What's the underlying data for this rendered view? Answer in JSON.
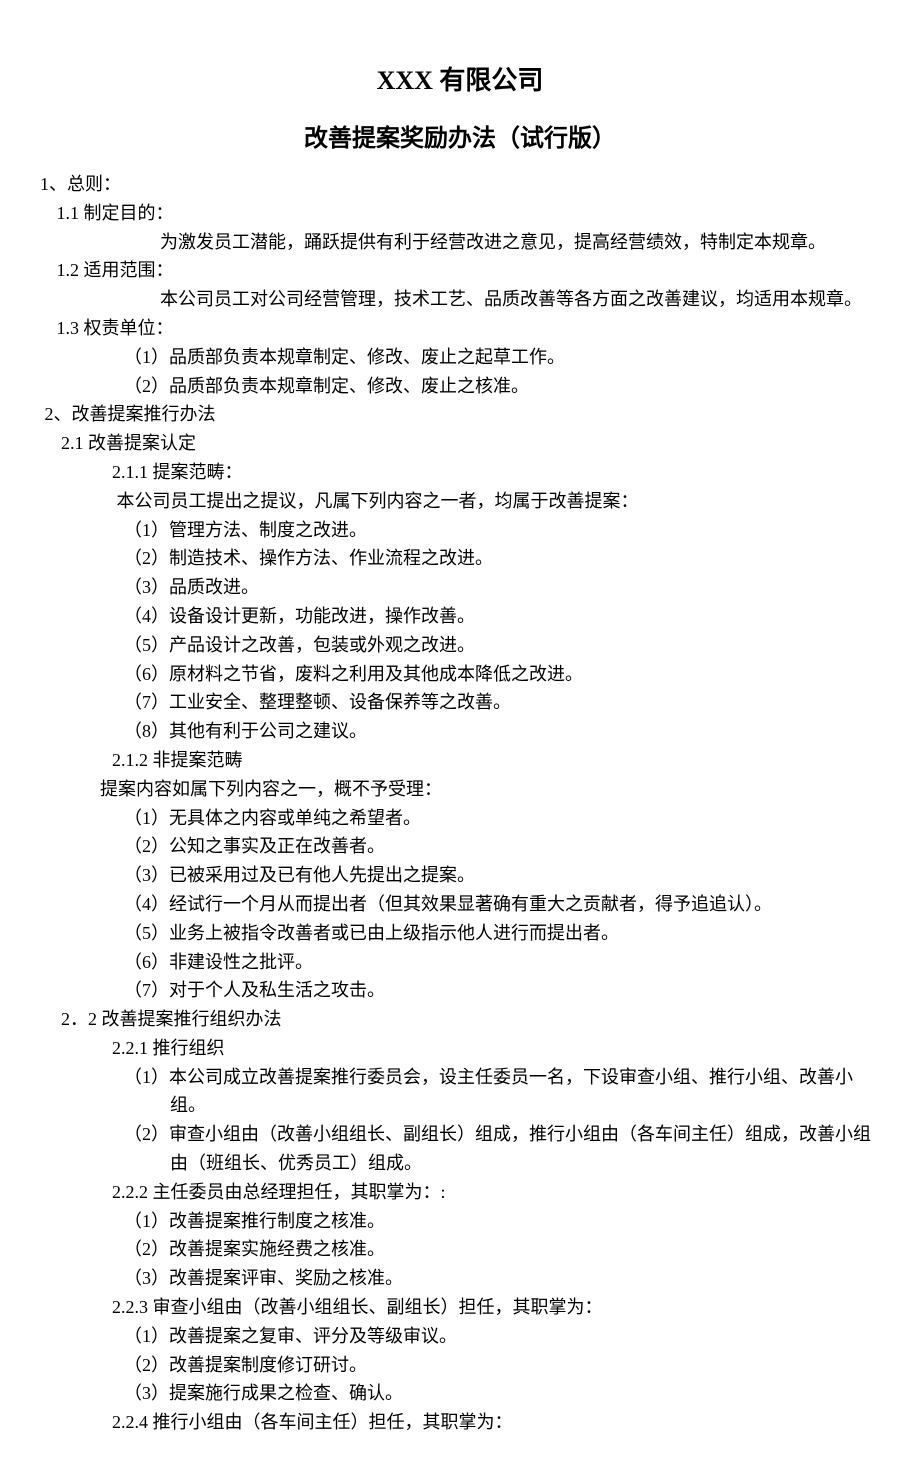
{
  "title_main": "XXX 有限公司",
  "title_sub": "改善提案奖励办法（试行版）",
  "s1": "1、总则：",
  "s1_1": " 1.1 制定目的：",
  "s1_1_body": "为激发员工潜能，踊跃提供有利于经营改进之意见，提高经营绩效，特制定本规章。",
  "s1_2": " 1.2 适用范围：",
  "s1_2_body": "本公司员工对公司经营管理，技术工艺、品质改善等各方面之改善建议，均适用本规章。",
  "s1_3": " 1.3 权责单位：",
  "s1_3_items": [
    "（1）品质部负责本规章制定、修改、废止之起草工作。",
    "（2）品质部负责本规章制定、修改、废止之核准。"
  ],
  "s2": " 2、改善提案推行办法",
  "s2_1": "  2.1 改善提案认定",
  "s2_1_1": "2.1.1 提案范畴：",
  "s2_1_1_intro": " 本公司员工提出之提议，凡属下列内容之一者，均属于改善提案：",
  "s2_1_1_items": [
    "（1）管理方法、制度之改进。",
    "（2）制造技术、操作方法、作业流程之改进。",
    "（3）品质改进。",
    "（4）设备设计更新，功能改进，操作改善。",
    "（5）产品设计之改善，包装或外观之改进。",
    "（6）原材料之节省，废料之利用及其他成本降低之改进。",
    "（7）工业安全、整理整顿、设备保养等之改善。",
    "（8）其他有利于公司之建议。"
  ],
  "s2_1_2": "2.1.2 非提案范畴",
  "s2_1_2_intro": "提案内容如属下列内容之一，概不予受理：",
  "s2_1_2_items": [
    "（1）无具体之内容或单纯之希望者。",
    "（2）公知之事实及正在改善者。",
    "（3）已被采用过及已有他人先提出之提案。",
    "（4）经试行一个月从而提出者（但其效果显著确有重大之贡献者，得予追追认）。",
    "（5）业务上被指令改善者或已由上级指示他人进行而提出者。",
    "（6）非建设性之批评。",
    "（7）对于个人及私生活之攻击。"
  ],
  "s2_2": "  2．2 改善提案推行组织办法",
  "s2_2_1": "2.2.1 推行组织",
  "s2_2_1_items": [
    "（1）本公司成立改善提案推行委员会，设主任委员一名，下设审查小组、推行小组、改善小组。",
    "（2）审查小组由（改善小组组长、副组长）组成，推行小组由（各车间主任）组成，改善小组由（班组长、优秀员工）组成。"
  ],
  "s2_2_2": "2.2.2 主任委员由总经理担任，其职掌为：:",
  "s2_2_2_items": [
    "（1）改善提案推行制度之核准。",
    "（2）改善提案实施经费之核准。",
    "（3）改善提案评审、奖励之核准。"
  ],
  "s2_2_3": "2.2.3 审查小组由（改善小组组长、副组长）担任，其职掌为：",
  "s2_2_3_items": [
    "（1）改善提案之复审、评分及等级审议。",
    "（2）改善提案制度修订研讨。",
    "（3）提案施行成果之检查、确认。"
  ],
  "s2_2_4": "2.2.4 推行小组由（各车间主任）担任，其职掌为："
}
